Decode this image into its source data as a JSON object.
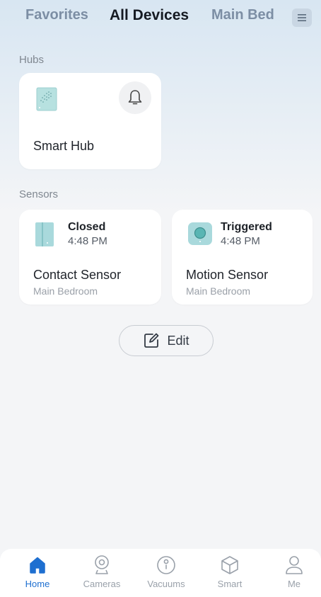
{
  "header": {
    "tabs": [
      {
        "label": "Favorites",
        "active": false
      },
      {
        "label": "All Devices",
        "active": true
      },
      {
        "label": "Main Bed",
        "active": false
      }
    ],
    "menu_icon": "hamburger-menu-icon"
  },
  "hubs": {
    "section_label": "Hubs",
    "items": [
      {
        "name": "Smart Hub",
        "icon": "smart-hub-device-icon",
        "action_icon": "bell-icon"
      }
    ]
  },
  "sensors": {
    "section_label": "Sensors",
    "items": [
      {
        "name": "Contact Sensor",
        "room": "Main Bedroom",
        "status": "Closed",
        "time": "4:48 PM",
        "icon": "contact-sensor-icon"
      },
      {
        "name": "Motion Sensor",
        "room": "Main Bedroom",
        "status": "Triggered",
        "time": "4:48 PM",
        "icon": "motion-sensor-icon"
      }
    ]
  },
  "edit_button": {
    "label": "Edit",
    "icon": "edit-icon"
  },
  "bottom_nav": {
    "items": [
      {
        "label": "Home",
        "icon": "home-icon",
        "active": true
      },
      {
        "label": "Cameras",
        "icon": "camera-icon",
        "active": false
      },
      {
        "label": "Vacuums",
        "icon": "vacuum-icon",
        "active": false
      },
      {
        "label": "Smart",
        "icon": "smart-cube-icon",
        "active": false
      },
      {
        "label": "Me",
        "icon": "person-icon",
        "active": false
      }
    ]
  },
  "colors": {
    "accent": "#1e6fd0",
    "device_teal": "#a9d9dc",
    "active_text": "#151a22",
    "inactive_tab": "#7c8ea4"
  }
}
